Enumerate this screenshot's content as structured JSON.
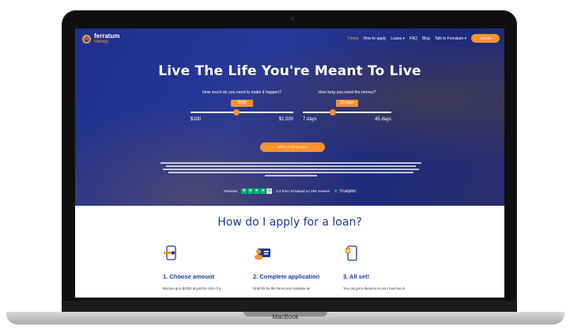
{
  "device": {
    "label": "MacBook"
  },
  "nav": {
    "logo_main": "ferratum",
    "logo_sub": "money",
    "logo_letter": "fe",
    "items": [
      {
        "label": "Home",
        "active": true
      },
      {
        "label": "How to apply"
      },
      {
        "label": "Loans ▾"
      },
      {
        "label": "FAQ"
      },
      {
        "label": "Blog"
      },
      {
        "label": "Talk to Ferratum ▾"
      }
    ],
    "login_label": "LOGIN"
  },
  "hero": {
    "title": "Live The Life You're Meant To Live",
    "amount": {
      "question": "How much do you need to make it happen?",
      "value": "$500",
      "min": "$100",
      "max": "$1,000",
      "fill": 0.444
    },
    "duration": {
      "question": "How long you need the money?",
      "value": "20 days",
      "min": "7 days",
      "max": "45 days",
      "fill": 0.342
    },
    "apply_label": "APPLY FOR A LOAN"
  },
  "reviews": {
    "label": "Reviews",
    "stars": 4,
    "score_text": "8.4 from 10 based on 294 reviews",
    "brand": "Trustpilot"
  },
  "how_to": {
    "title": "How do I apply for a loan?",
    "steps": [
      {
        "name": "1. Choose amount",
        "text": "Borrow up to $1000 at just the click of a",
        "icon": "phone-slider-icon"
      },
      {
        "name": "2. Complete application",
        "text": "Grab life by the horns and complete an",
        "icon": "id-card-icon"
      },
      {
        "name": "3. All set!",
        "text": "You can get a decision on your loan live in",
        "icon": "phone-check-icon"
      }
    ]
  },
  "colors": {
    "primary": "#1f3a8a",
    "accent": "#f7932c",
    "trustpilot": "#00b67a"
  }
}
